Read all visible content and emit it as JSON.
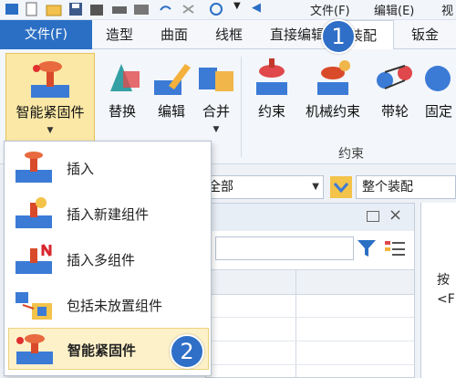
{
  "quick_access": {
    "menu_file": "文件(F)",
    "menu_edit": "编辑(E)",
    "menu_view": "视"
  },
  "tabs": {
    "file": "文件(F)",
    "items": [
      "造型",
      "曲面",
      "线框",
      "直接编辑",
      "装配",
      "钣金"
    ]
  },
  "ribbon": {
    "buttons": [
      {
        "label": "智能紧固件",
        "icon": "smart-fastener-icon"
      },
      {
        "label": "替换",
        "icon": "replace-icon"
      },
      {
        "label": "编辑",
        "icon": "edit-icon"
      },
      {
        "label": "合并",
        "icon": "merge-icon"
      },
      {
        "label": "约束",
        "icon": "constraint-icon"
      },
      {
        "label": "机械约束",
        "icon": "mechanical-constraint-icon"
      },
      {
        "label": "带轮",
        "icon": "pulley-icon"
      },
      {
        "label": "固定",
        "icon": "fixed-icon"
      }
    ],
    "group_label": "约束"
  },
  "dropdown": {
    "items": [
      {
        "label": "插入",
        "icon": "insert-icon"
      },
      {
        "label": "插入新建组件",
        "icon": "insert-new-component-icon"
      },
      {
        "label": "插入多组件",
        "icon": "insert-multiple-components-icon"
      },
      {
        "label": "包括未放置组件",
        "icon": "include-unplaced-components-icon"
      },
      {
        "label": "智能紧固件",
        "icon": "smart-fastener-icon"
      }
    ]
  },
  "filter_bar": {
    "scope": "全部",
    "assembly": "整个装配"
  },
  "right_pane": {
    "line1": "按",
    "line2": "<F"
  },
  "badges": {
    "one": "1",
    "two": "2"
  },
  "colors": {
    "accent": "#2b6fc4",
    "highlight": "#fbe8a6",
    "badge": "#2f6fc7"
  }
}
